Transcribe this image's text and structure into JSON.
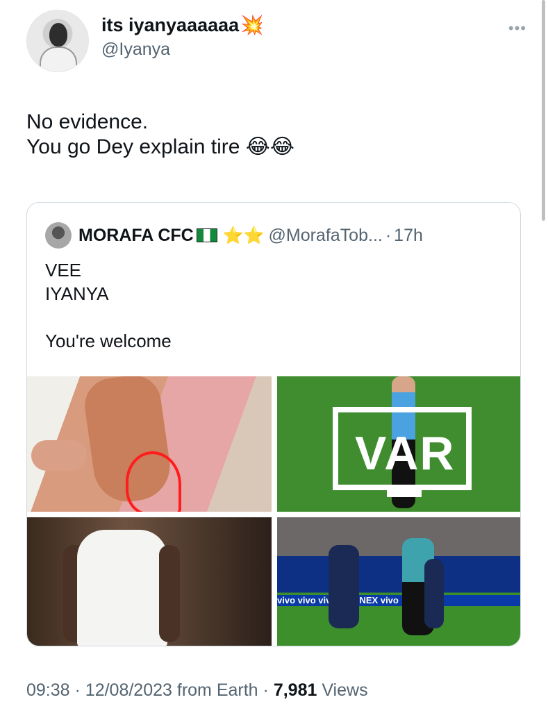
{
  "tweet": {
    "author": {
      "display_name": "its iyanyaaaaaa",
      "name_emoji": "💥",
      "handle": "@Iyanya"
    },
    "more_icon": "more-horizontal-icon",
    "text_line1": "No evidence.",
    "text_line2": "You go Dey explain tire",
    "text_emoji": "😂😂",
    "time": "09:38",
    "date": "12/08/2023",
    "source": "from Earth",
    "separator": "·",
    "views_count": "7,981",
    "views_label": "Views"
  },
  "quote": {
    "display_name": "MORAFA CFC",
    "name_emoji": "⭐⭐",
    "handle": "@MorafaTob...",
    "age": "17h",
    "separator": "·",
    "text_lines": [
      "VEE",
      "IYANYA",
      "",
      "You're welcome"
    ],
    "media": {
      "var_text": "VAR",
      "adboard_text": "vivo  vivo  vivo  vivo NEX  vivo"
    }
  }
}
